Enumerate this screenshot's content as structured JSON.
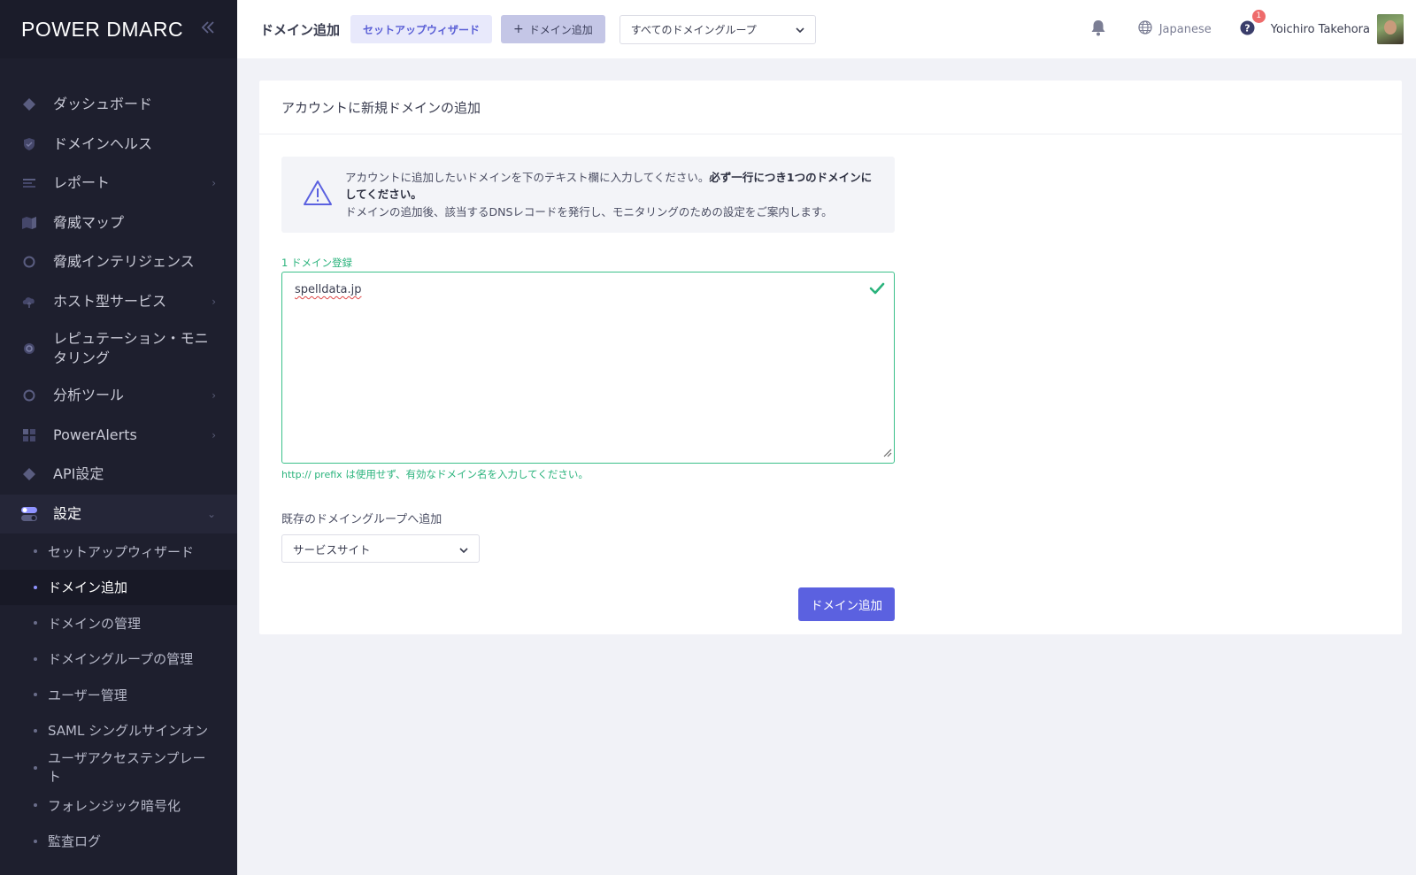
{
  "brand": {
    "logo_text": "POWER DMARC"
  },
  "sidebar": {
    "items": [
      {
        "label": "ダッシュボード",
        "icon": "diamond-icon",
        "chevron": false
      },
      {
        "label": "ドメインヘルス",
        "icon": "shield-check-icon",
        "chevron": false
      },
      {
        "label": "レポート",
        "icon": "report-lines-icon",
        "chevron": true
      },
      {
        "label": "脅威マップ",
        "icon": "map-icon",
        "chevron": false
      },
      {
        "label": "脅威インテリジェンス",
        "icon": "ring-icon",
        "chevron": false
      },
      {
        "label": "ホスト型サービス",
        "icon": "cloud-upload-icon",
        "chevron": true
      },
      {
        "label": "レピュテーション・モニタリング",
        "icon": "gear-ring-icon",
        "chevron": false
      },
      {
        "label": "分析ツール",
        "icon": "ring-icon",
        "chevron": true
      },
      {
        "label": "PowerAlerts",
        "icon": "grid-icon",
        "chevron": true
      },
      {
        "label": "API設定",
        "icon": "diamond-icon",
        "chevron": false
      },
      {
        "label": "設定",
        "icon": "toggle-icon",
        "chevron": true
      }
    ],
    "sub_items": [
      {
        "label": "セットアップウィザード"
      },
      {
        "label": "ドメイン追加",
        "active": true
      },
      {
        "label": "ドメインの管理"
      },
      {
        "label": "ドメイングループの管理"
      },
      {
        "label": "ユーザー管理"
      },
      {
        "label": "SAML シングルサインオン"
      },
      {
        "label": "ユーザアクセステンプレート"
      },
      {
        "label": "フォレンジック暗号化"
      },
      {
        "label": "監査ログ"
      }
    ]
  },
  "header": {
    "title": "ドメイン追加",
    "wizard_button": "セットアップウィザード",
    "add_button": "ドメイン追加",
    "group_select": "すべてのドメイングループ",
    "language": "Japanese",
    "help_badge": "1",
    "user_name": "Yoichiro Takehora"
  },
  "card": {
    "title": "アカウントに新規ドメインの追加",
    "alert": {
      "line1": "アカウントに追加したいドメインを下のテキスト欄に入力してください。",
      "line1_bold": "必ず一行につき1つのドメインにしてください。",
      "line2": "ドメインの追加後、該当するDNSレコードを発行し、モニタリングのための設定をご案内します。"
    },
    "domain_count_label": "1 ドメイン登録",
    "textarea_value": "spelldata.jp",
    "hint_prefix": "http:// prefix",
    "hint_text": " は使用せず、有効なドメイン名を入力してください。",
    "group_label": "既存のドメイングループへ追加",
    "group_value": "サービスサイト",
    "submit_button": "ドメイン追加"
  },
  "colors": {
    "sidebar_bg": "#1e1f2e",
    "accent": "#5b61e0",
    "success": "#2ab37c",
    "badge": "#ee6b6b"
  }
}
